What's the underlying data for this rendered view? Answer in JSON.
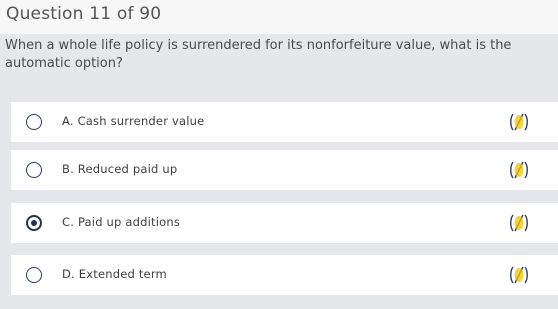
{
  "header": {
    "title": "Question 11 of 90"
  },
  "question": {
    "text": "When a whole life policy is surrendered for its nonforfeiture value, what is the automatic option?"
  },
  "options": [
    {
      "label": "A. Cash surrender value",
      "selected": false
    },
    {
      "label": "B. Reduced paid up",
      "selected": false
    },
    {
      "label": "C. Paid up additions",
      "selected": true
    },
    {
      "label": "D. Extended term",
      "selected": false
    }
  ],
  "colors": {
    "eliminate_icon": "#f2c400",
    "radio_border": "#2f3d58",
    "background": "#e6e7ea"
  },
  "icons": {
    "eliminate": "eliminate-answer-icon"
  }
}
